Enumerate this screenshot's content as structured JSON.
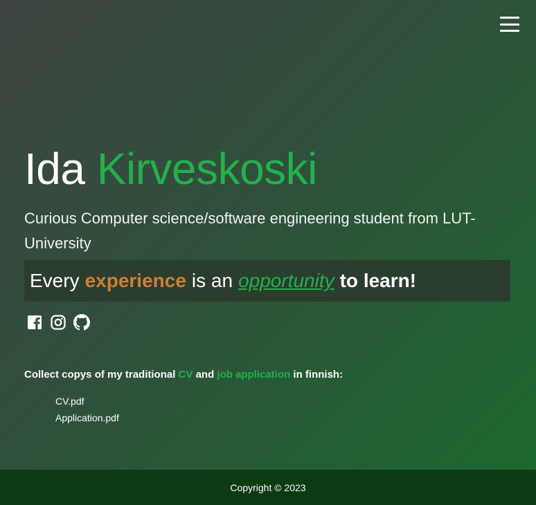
{
  "header": {
    "menu_icon": "hamburger-menu-icon"
  },
  "hero": {
    "first_name": "Ida",
    "last_name": "Kirveskoski",
    "subtitle": "Curious Computer science/software engineering student from LUT-University",
    "motto": {
      "every": "Every",
      "experience": "experience",
      "is_an": "is an",
      "opportunity": "opportunity",
      "to_learn": "to learn!"
    },
    "accent_green": "#22b14c",
    "accent_orange": "#cf7e3a"
  },
  "social": {
    "icons": [
      "facebook-icon",
      "instagram-icon",
      "github-icon"
    ]
  },
  "documents": {
    "intro_prefix": "Collect copys of my traditional",
    "cv_word": "CV",
    "and_word": "and",
    "application_word": "job application",
    "intro_suffix": "in finnish:",
    "files": [
      "CV.pdf",
      "Application.pdf"
    ]
  },
  "footer": {
    "copyright": "Copyright © 2023"
  }
}
